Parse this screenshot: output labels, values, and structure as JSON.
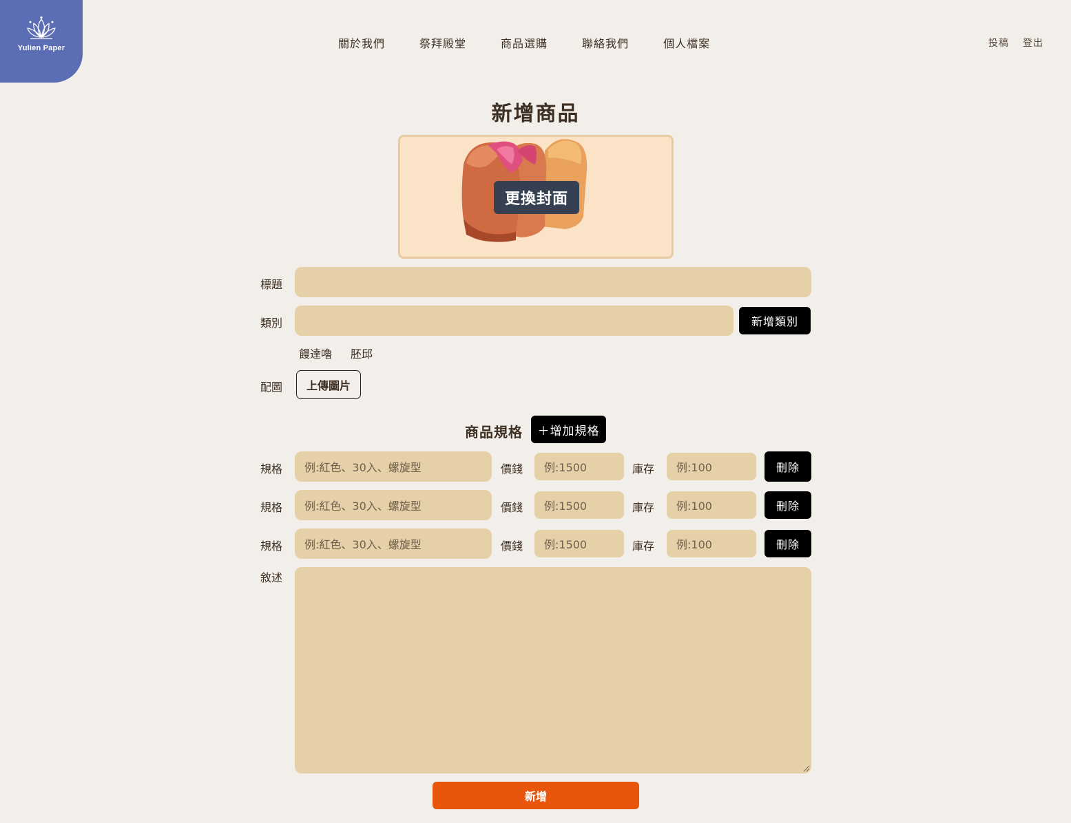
{
  "logo": {
    "text": "Yulien Paper",
    "icon": "lotus-icon",
    "color": "#5b6db4"
  },
  "nav": {
    "items": [
      "關於我們",
      "祭拜殿堂",
      "商品選購",
      "聯絡我們",
      "個人檔案"
    ],
    "right": [
      "投稿",
      "登出"
    ]
  },
  "page": {
    "title": "新增商品"
  },
  "cover": {
    "button": "更換封面"
  },
  "form": {
    "title_label": "標題",
    "category_label": "類別",
    "add_category_button": "新增類別",
    "category_tags": [
      "饅達嚕",
      "胚邱"
    ],
    "image_label": "配圖",
    "upload_button": "上傳圖片",
    "spec_section_title": "商品規格",
    "add_spec_button": "＋增加規格",
    "spec_rows": [
      {
        "spec_label": "規格",
        "spec_placeholder": "例:紅色、30入、螺旋型",
        "price_label": "價錢",
        "price_placeholder": "例:1500",
        "stock_label": "庫存",
        "stock_placeholder": "例:100",
        "delete_button": "刪除"
      },
      {
        "spec_label": "規格",
        "spec_placeholder": "例:紅色、30入、螺旋型",
        "price_label": "價錢",
        "price_placeholder": "例:1500",
        "stock_label": "庫存",
        "stock_placeholder": "例:100",
        "delete_button": "刪除"
      },
      {
        "spec_label": "規格",
        "spec_placeholder": "例:紅色、30入、螺旋型",
        "price_label": "價錢",
        "price_placeholder": "例:1500",
        "stock_label": "庫存",
        "stock_placeholder": "例:100",
        "delete_button": "刪除"
      }
    ],
    "description_label": "敘述",
    "submit_button": "新增"
  },
  "colors": {
    "background": "#f2eee9",
    "field": "#e5d0a7",
    "submit": "#e8560d",
    "cover_bg": "#fbe3c8"
  }
}
